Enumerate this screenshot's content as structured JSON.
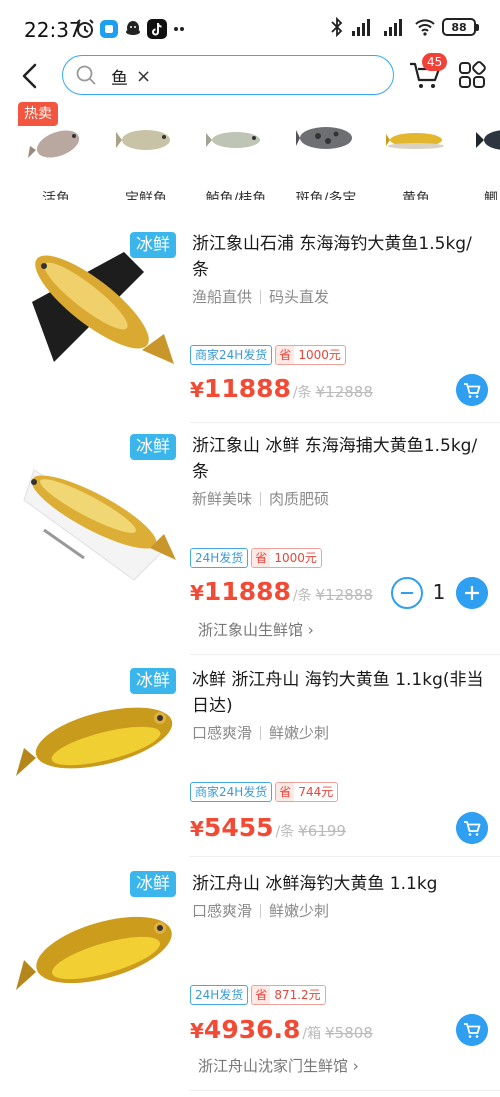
{
  "status_bar": {
    "time": "22:37",
    "battery": "88"
  },
  "search": {
    "query": "鱼",
    "clear_symbol": "×"
  },
  "header": {
    "cart_count": "45"
  },
  "categories": {
    "hot_label": "热卖",
    "items": [
      {
        "label": "活鱼"
      },
      {
        "label": "宝鲜鱼"
      },
      {
        "label": "鲈鱼/桂鱼"
      },
      {
        "label": "斑鱼/多宝"
      },
      {
        "label": "黄鱼"
      },
      {
        "label": "鲫"
      }
    ]
  },
  "products": [
    {
      "tag": "冰鲜",
      "title": "浙江象山石浦 东海海钓大黄鱼1.5kg/条",
      "features": [
        "渔船直供",
        "码头直发"
      ],
      "shipping": "商家24H发货",
      "save_label": "省",
      "save_amount": "1000元",
      "price_symbol": "¥",
      "price": "11888",
      "unit": "/条",
      "old_price": "¥12888"
    },
    {
      "tag": "冰鲜",
      "title": "浙江象山 冰鲜 东海海捕大黄鱼1.5kg/条",
      "features": [
        "新鲜美味",
        "肉质肥硕"
      ],
      "shipping": "24H发货",
      "save_label": "省",
      "save_amount": "1000元",
      "price_symbol": "¥",
      "price": "11888",
      "unit": "/条",
      "old_price": "¥12888",
      "quantity": "1",
      "store": "浙江象山生鲜馆 ›"
    },
    {
      "tag": "冰鲜",
      "title": "冰鲜 浙江舟山 海钓大黄鱼 1.1kg(非当日达)",
      "features": [
        "口感爽滑",
        "鲜嫩少刺"
      ],
      "shipping": "商家24H发货",
      "save_label": "省",
      "save_amount": "744元",
      "price_symbol": "¥",
      "price": "5455",
      "unit": "/条",
      "old_price": "¥6199"
    },
    {
      "tag": "冰鲜",
      "title": "浙江舟山 冰鲜海钓大黄鱼 1.1kg",
      "features": [
        "口感爽滑",
        "鲜嫩少刺"
      ],
      "shipping": "24H发货",
      "save_label": "省",
      "save_amount": "871.2元",
      "price_symbol": "¥",
      "price": "4936.8",
      "unit": "/箱",
      "old_price": "¥5808",
      "store": "浙江舟山沈家门生鲜馆 ›"
    }
  ],
  "colors": {
    "accent_blue": "#2f9ff1",
    "price_red": "#f24a34",
    "hot_red": "#f25640",
    "fresh_blue": "#3ab6ec"
  }
}
